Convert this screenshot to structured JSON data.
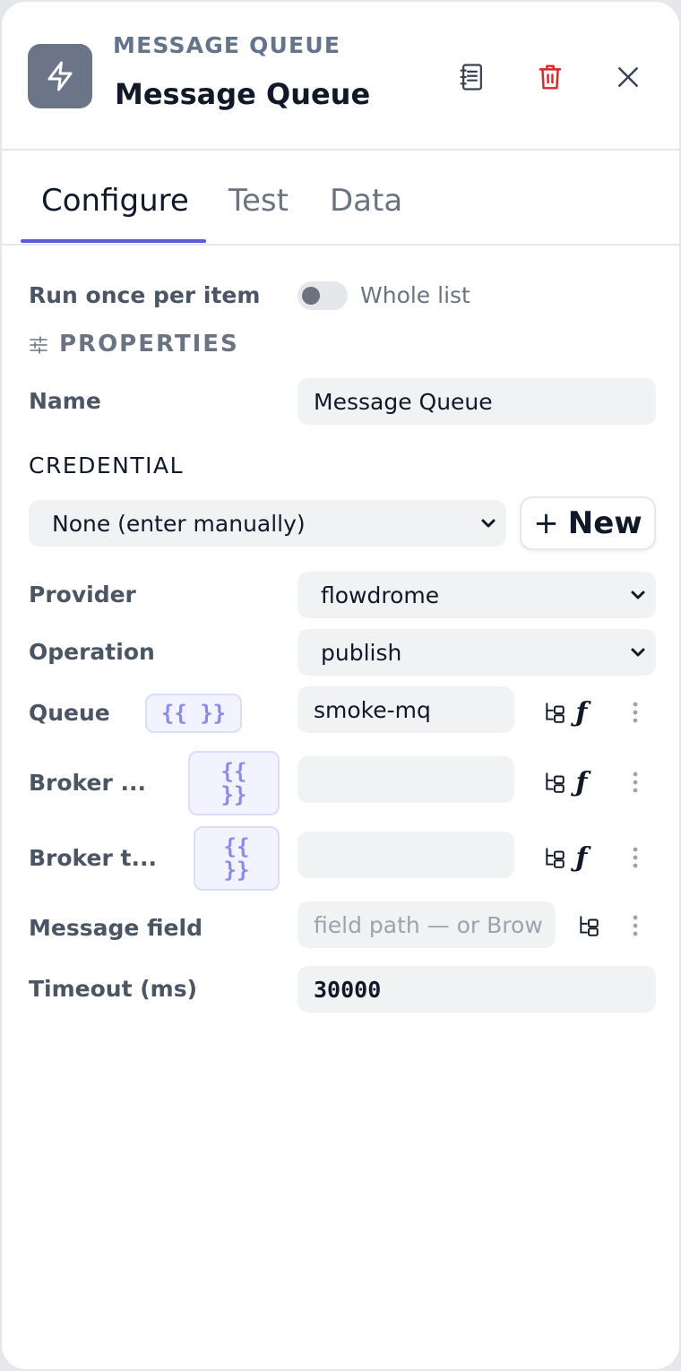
{
  "header": {
    "type_label": "MESSAGE QUEUE",
    "node_name": "Message Queue",
    "icons": {
      "node": "lightning-icon",
      "docs": "notebook-icon",
      "delete": "trash-icon",
      "close": "close-icon"
    },
    "delete_color": "#dc2626"
  },
  "tabs": [
    {
      "label": "Configure",
      "active": true
    },
    {
      "label": "Test",
      "active": false
    },
    {
      "label": "Data",
      "active": false
    }
  ],
  "run_mode": {
    "label": "Run once per item",
    "toggle_label": "Whole list",
    "enabled": false
  },
  "properties": {
    "heading": "PROPERTIES",
    "icon": "sliders-icon"
  },
  "name_field": {
    "label": "Name",
    "value": "Message Queue"
  },
  "credential": {
    "heading": "CREDENTIAL",
    "selected": "None (enter manually)",
    "new_button": {
      "plus": "+",
      "label": "New"
    }
  },
  "provider": {
    "label": "Provider",
    "value": "flowdrome"
  },
  "operation": {
    "label": "Operation",
    "value": "publish"
  },
  "queue": {
    "label": "Queue",
    "expr": "{{ }}",
    "value": "smoke-mq"
  },
  "broker_url": {
    "label": "Broker ...",
    "expr_top": "{{",
    "expr_bottom": "}}",
    "value": ""
  },
  "broker_token": {
    "label": "Broker t...",
    "expr_top": "{{",
    "expr_bottom": "}}",
    "value": ""
  },
  "message_field": {
    "label": "Message field",
    "placeholder": "field path — or Brow"
  },
  "timeout": {
    "label": "Timeout (ms)",
    "value": "30000"
  },
  "field_icons": {
    "browse": "tree-browse-icon",
    "function": "function-icon",
    "function_glyph": "ƒ",
    "more": "more-vertical-icon"
  },
  "accent_color": "#5b5bd6"
}
